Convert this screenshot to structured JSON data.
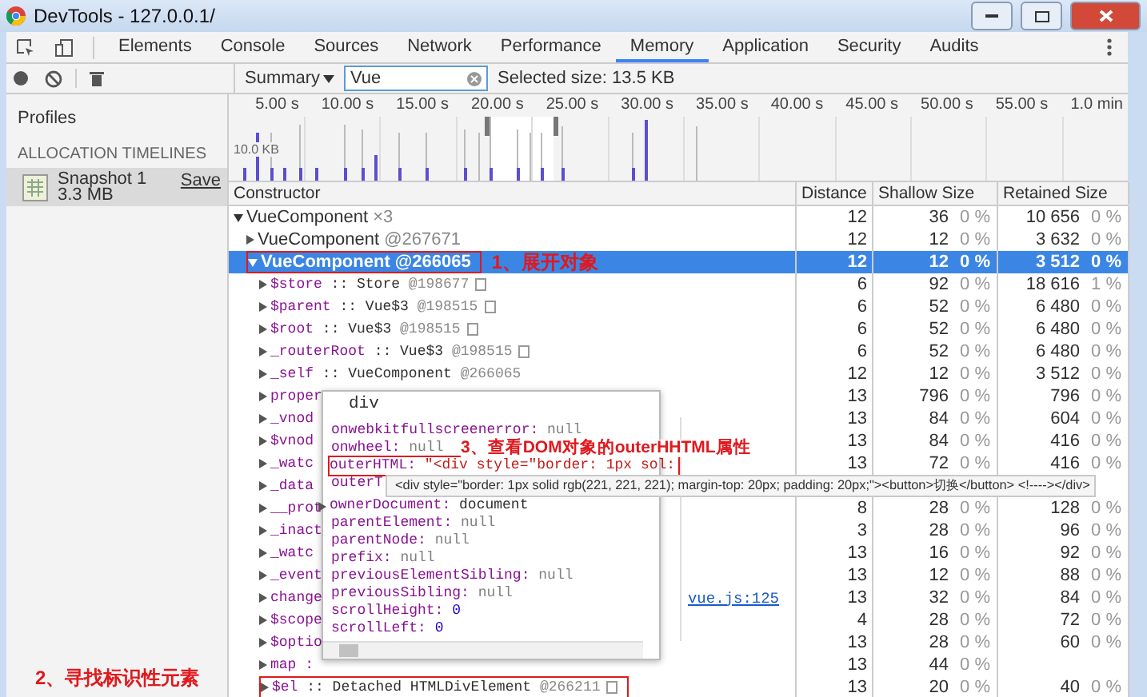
{
  "window": {
    "title": "DevTools - 127.0.0.1/"
  },
  "tabs": [
    {
      "label": "Elements",
      "selected": false
    },
    {
      "label": "Console",
      "selected": false
    },
    {
      "label": "Sources",
      "selected": false
    },
    {
      "label": "Network",
      "selected": false
    },
    {
      "label": "Performance",
      "selected": false
    },
    {
      "label": "Memory",
      "selected": true
    },
    {
      "label": "Application",
      "selected": false
    },
    {
      "label": "Security",
      "selected": false
    },
    {
      "label": "Audits",
      "selected": false
    }
  ],
  "toolbar": {
    "view": "Summary",
    "filter": "Vue",
    "selected_size": "Selected size: 13.5 KB"
  },
  "sidebar": {
    "heading": "Profiles",
    "section": "ALLOCATION TIMELINES",
    "items": [
      {
        "name": "Snapshot 1",
        "size": "3.3 MB",
        "action": "Save",
        "selected": true
      }
    ],
    "note": "2、寻找标识性元素"
  },
  "timeline": {
    "ticks": [
      "5.00 s",
      "10.00 s",
      "15.00 s",
      "20.00 s",
      "25.00 s",
      "30.00 s",
      "35.00 s",
      "40.00 s",
      "45.00 s",
      "50.00 s",
      "55.00 s",
      "1.0 min"
    ],
    "scale": "10.0 KB"
  },
  "table": {
    "columns": [
      "Constructor",
      "Distance",
      "Shallow Size",
      "Retained Size"
    ],
    "rows": [
      {
        "name": "VueComponent",
        "count": "×3",
        "distance": "12",
        "shallow": "36",
        "shallow_pct": "0 %",
        "retained": "10 656",
        "retained_pct": "0 %",
        "expanded": true,
        "selected": false,
        "children": [
          {
            "name": "VueComponent",
            "id": "@267671",
            "distance": "12",
            "shallow": "12",
            "shallow_pct": "0 %",
            "retained": "3 632",
            "retained_pct": "0 %",
            "expanded": false,
            "selected": false
          },
          {
            "name": "VueComponent",
            "id": "@266065",
            "distance": "12",
            "shallow": "12",
            "shallow_pct": "0 %",
            "retained": "3 512",
            "retained_pct": "0 %",
            "expanded": true,
            "selected": true,
            "outlined": true,
            "note": "1、展开对象",
            "children": [
              {
                "key": "$store",
                "value": ":: Store",
                "id": "@198677",
                "reveal": true,
                "distance": "6",
                "shallow": "92",
                "shallow_pct": "0 %",
                "retained": "18 616",
                "retained_pct": "1 %",
                "expanded": false,
                "selected": false
              },
              {
                "key": "$parent",
                "value": ":: Vue$3",
                "id": "@198515",
                "reveal": true,
                "distance": "6",
                "shallow": "52",
                "shallow_pct": "0 %",
                "retained": "6 480",
                "retained_pct": "0 %",
                "expanded": false,
                "selected": false
              },
              {
                "key": "$root",
                "value": ":: Vue$3",
                "id": "@198515",
                "reveal": true,
                "distance": "6",
                "shallow": "52",
                "shallow_pct": "0 %",
                "retained": "6 480",
                "retained_pct": "0 %",
                "expanded": false,
                "selected": false
              },
              {
                "key": "_routerRoot",
                "value": ":: Vue$3",
                "id": "@198515",
                "reveal": true,
                "distance": "6",
                "shallow": "52",
                "shallow_pct": "0 %",
                "retained": "6 480",
                "retained_pct": "0 %",
                "expanded": false,
                "selected": false
              },
              {
                "key": "_self",
                "value": ":: VueComponent",
                "id": "@266065",
                "distance": "12",
                "shallow": "12",
                "shallow_pct": "0 %",
                "retained": "3 512",
                "retained_pct": "0 %",
                "expanded": false,
                "selected": false
              },
              {
                "key": "proper",
                "distance": "13",
                "shallow": "796",
                "shallow_pct": "0 %",
                "retained": "796",
                "retained_pct": "0 %",
                "expanded": false,
                "selected": false
              },
              {
                "key": "_vnod",
                "distance": "13",
                "shallow": "84",
                "shallow_pct": "0 %",
                "retained": "604",
                "retained_pct": "0 %",
                "expanded": false,
                "selected": false
              },
              {
                "key": "$vnod",
                "distance": "13",
                "shallow": "84",
                "shallow_pct": "0 %",
                "retained": "416",
                "retained_pct": "0 %",
                "expanded": false,
                "selected": false
              },
              {
                "key": "_watc",
                "distance": "13",
                "shallow": "72",
                "shallow_pct": "0 %",
                "retained": "416",
                "retained_pct": "0 %",
                "expanded": false,
                "selected": false
              },
              {
                "key": "_data",
                "expanded": false,
                "selected": false
              },
              {
                "key": "__prot",
                "distance": "8",
                "shallow": "28",
                "shallow_pct": "0 %",
                "retained": "128",
                "retained_pct": "0 %",
                "expanded": false,
                "selected": false
              },
              {
                "key": "_inact",
                "distance": "3",
                "shallow": "28",
                "shallow_pct": "0 %",
                "retained": "96",
                "retained_pct": "0 %",
                "expanded": false,
                "selected": false
              },
              {
                "key": "_watc",
                "distance": "13",
                "shallow": "16",
                "shallow_pct": "0 %",
                "retained": "92",
                "retained_pct": "0 %",
                "expanded": false,
                "selected": false
              },
              {
                "key": "_event",
                "distance": "13",
                "shallow": "12",
                "shallow_pct": "0 %",
                "retained": "88",
                "retained_pct": "0 %",
                "expanded": false,
                "selected": false
              },
              {
                "key": "change",
                "link": "vue.js:125",
                "distance": "13",
                "shallow": "32",
                "shallow_pct": "0 %",
                "retained": "84",
                "retained_pct": "0 %",
                "expanded": false,
                "selected": false
              },
              {
                "key": "$scope",
                "distance": "4",
                "shallow": "28",
                "shallow_pct": "0 %",
                "retained": "72",
                "retained_pct": "0 %",
                "expanded": false,
                "selected": false
              },
              {
                "key": "$optio",
                "distance": "13",
                "shallow": "28",
                "shallow_pct": "0 %",
                "retained": "60",
                "retained_pct": "0 %",
                "expanded": false,
                "selected": false
              },
              {
                "key": "map :",
                "distance": "13",
                "shallow": "44",
                "shallow_pct": "0 %",
                "expanded": false,
                "selected": false
              },
              {
                "key": "$el",
                "value": ":: Detached HTMLDivElement",
                "id": "@266211",
                "reveal": true,
                "outlined": true,
                "distance": "13",
                "shallow": "20",
                "shallow_pct": "0 %",
                "retained": "40",
                "retained_pct": "0 %",
                "expanded": false,
                "selected": false
              }
            ]
          }
        ]
      }
    ]
  },
  "popup": {
    "title": "div",
    "note": "3、查看DOM对象的outerHHTML属性",
    "properties": [
      {
        "key": "onwebkitfullscreenerror:",
        "value": "null",
        "kind": "null"
      },
      {
        "key": "onwheel:",
        "value": "null",
        "kind": "null"
      },
      {
        "key": "outerHTML:",
        "value": "\"<div style=\"border: 1px sol:",
        "kind": "string",
        "outlined": true
      },
      {
        "key": "outerT"
      },
      {
        "key": "ownerDocument:",
        "value": "document",
        "kind": "object"
      },
      {
        "key": "parentElement:",
        "value": "null",
        "kind": "null"
      },
      {
        "key": "parentNode:",
        "value": "null",
        "kind": "null"
      },
      {
        "key": "prefix:",
        "value": "null",
        "kind": "null"
      },
      {
        "key": "previousElementSibling:",
        "value": "null",
        "kind": "null"
      },
      {
        "key": "previousSibling:",
        "value": "null",
        "kind": "null"
      },
      {
        "key": "scrollHeight:",
        "value": "0",
        "kind": "number"
      },
      {
        "key": "scrollLeft:",
        "value": "0",
        "kind": "number"
      }
    ],
    "tooltip": "<div style=\"border: 1px solid rgb(221, 221, 221); margin-top: 20px; padding: 20px;\"><button>切换</button> <!----></div>"
  }
}
